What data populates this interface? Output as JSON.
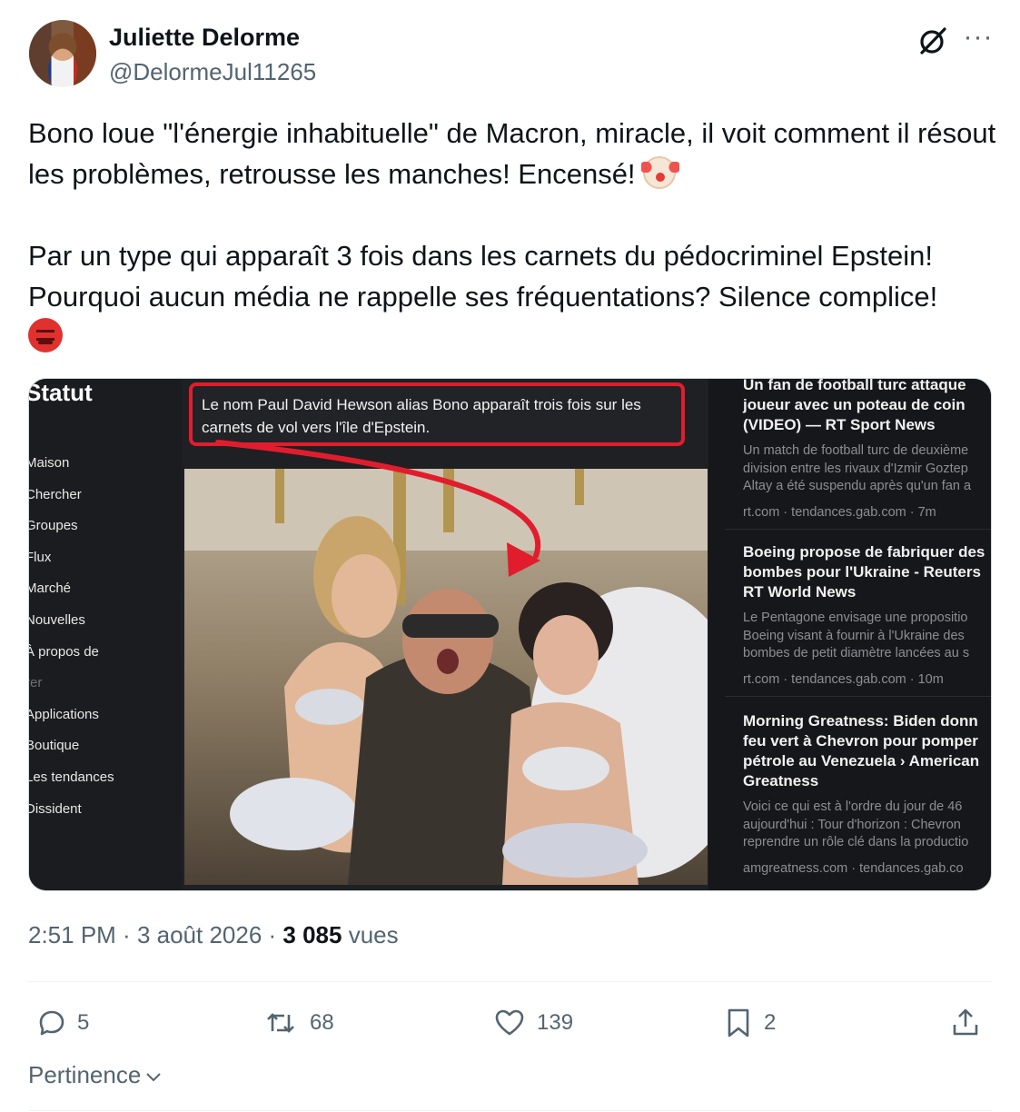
{
  "author": {
    "name": "Juliette Delorme",
    "handle": "@DelormeJul11265"
  },
  "icons": {
    "grok": "grok-icon",
    "more": "more-icon",
    "reply": "reply-icon",
    "retweet": "retweet-icon",
    "like": "like-icon",
    "bookmark": "bookmark-icon",
    "share": "share-icon",
    "chevron": "chevron-down-icon"
  },
  "tweet": {
    "paragraph1": "Bono loue \"l'énergie inhabituelle\" de Macron, miracle, il voit comment il résout les problèmes, retrousse les manches! Encensé! ",
    "paragraph2": "Par un type qui apparaît 3 fois dans les carnets du pédocriminel Epstein! Pourquoi aucun média ne rappelle ses fréquentations? Silence complice! "
  },
  "media": {
    "left_title": "Statut",
    "nav": [
      "Maison",
      "Chercher",
      "Groupes",
      "Flux",
      "Marché",
      "Nouvelles",
      "À propos de",
      "rer",
      "Applications",
      "Boutique",
      "Les tendances",
      "Dissident"
    ],
    "callout": "Le nom Paul David Hewson alias Bono apparaît trois fois sur les carnets de vol vers l'île d'Epstein.",
    "news": [
      {
        "title": "Un fan de football turc attaque\njoueur avec un poteau de coin\n(VIDEO) — RT Sport News",
        "desc": "Un match de football turc de deuxième\ndivision entre les rivaux d'Izmir Goztep\nAltay a été suspendu après qu'un fan a",
        "meta": "rt.com · tendances.gab.com · 7m"
      },
      {
        "title": "Boeing propose de fabriquer des\nbombes pour l'Ukraine - Reuters\nRT World News",
        "desc": "Le Pentagone envisage une propositio\nBoeing visant à fournir à l'Ukraine des\nbombes de petit diamètre lancées au s",
        "meta": "rt.com · tendances.gab.com · 10m"
      },
      {
        "title": "Morning Greatness: Biden donn\nfeu vert à Chevron pour pomper\npétrole au Venezuela › American\nGreatness",
        "desc": "Voici ce qui est à l'ordre du jour de 46\naujourd'hui : Tour d'horizon : Chevron\nreprendre un rôle clé dans la productio",
        "meta": "amgreatness.com · tendances.gab.co"
      }
    ]
  },
  "meta": {
    "time": "2:51 PM",
    "separator": " · ",
    "date": "3 août 2026",
    "views_count": "3 085",
    "views_label": " vues"
  },
  "actions": {
    "replies": "5",
    "retweets": "68",
    "likes": "139",
    "bookmarks": "2"
  },
  "sort": {
    "label": "Pertinence"
  },
  "colors": {
    "text": "#0f1419",
    "secondary": "#536471",
    "highlight_red": "#e11d2d"
  }
}
